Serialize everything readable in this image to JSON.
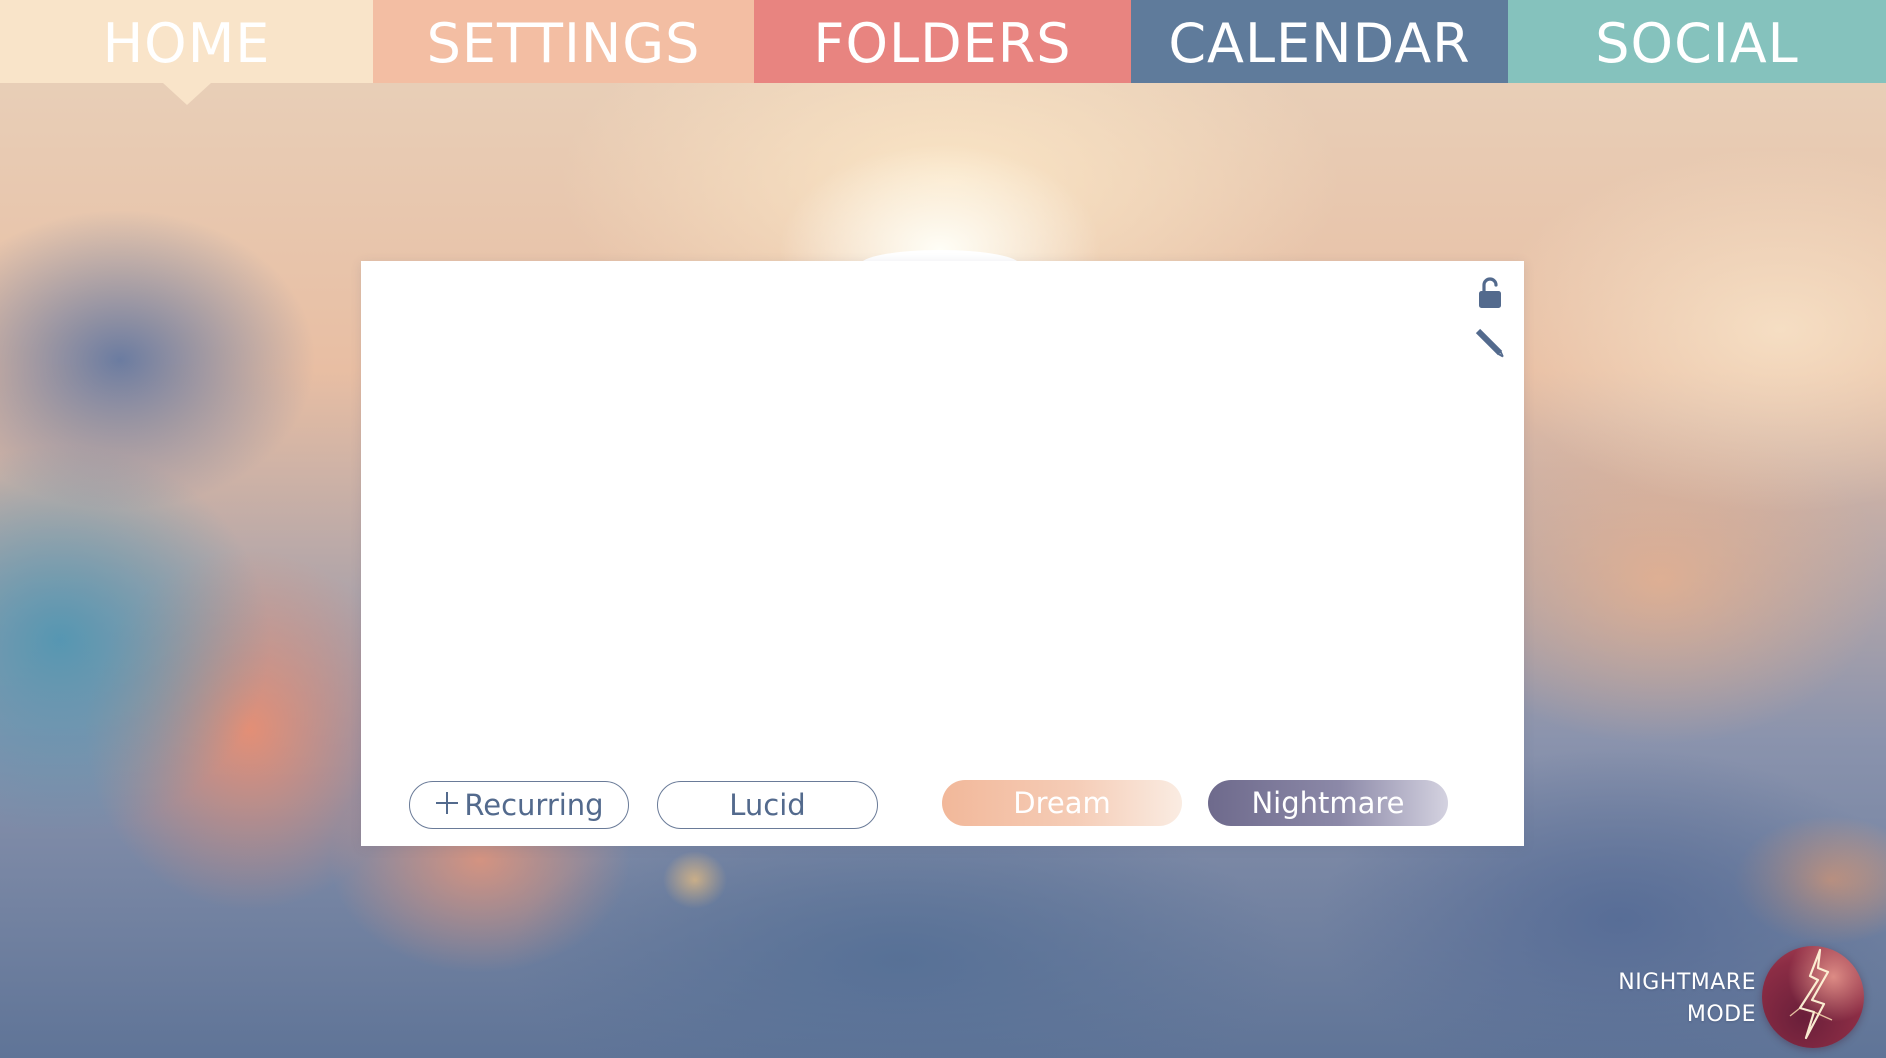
{
  "nav": {
    "tabs": [
      {
        "label": "HOME",
        "color": "#f9e4c9",
        "active": true
      },
      {
        "label": "SETTINGS",
        "color": "#f3bea3"
      },
      {
        "label": "FOLDERS",
        "color": "#e88480"
      },
      {
        "label": "CALENDAR",
        "color": "#5f7b9b"
      },
      {
        "label": "SOCIAL",
        "color": "#85c2bd"
      }
    ]
  },
  "card": {
    "icons": [
      "unlocked-padlock-icon",
      "pencil-icon"
    ],
    "buttons": {
      "recurring": {
        "icon": "plus-icon",
        "label": "Recurring"
      },
      "lucid": {
        "label": "Lucid"
      },
      "dream": {
        "label": "Dream"
      },
      "nightmare": {
        "label": "Nightmare"
      }
    }
  },
  "nightmare_mode": {
    "line1": "NIGHTMARE",
    "line2": "MODE",
    "icon": "lightning-orb-icon"
  },
  "colors": {
    "accent_dark": "#536a8d",
    "dream_gradient_start": "#f2b89a",
    "nightmare_gradient_start": "#6e6a8c"
  }
}
